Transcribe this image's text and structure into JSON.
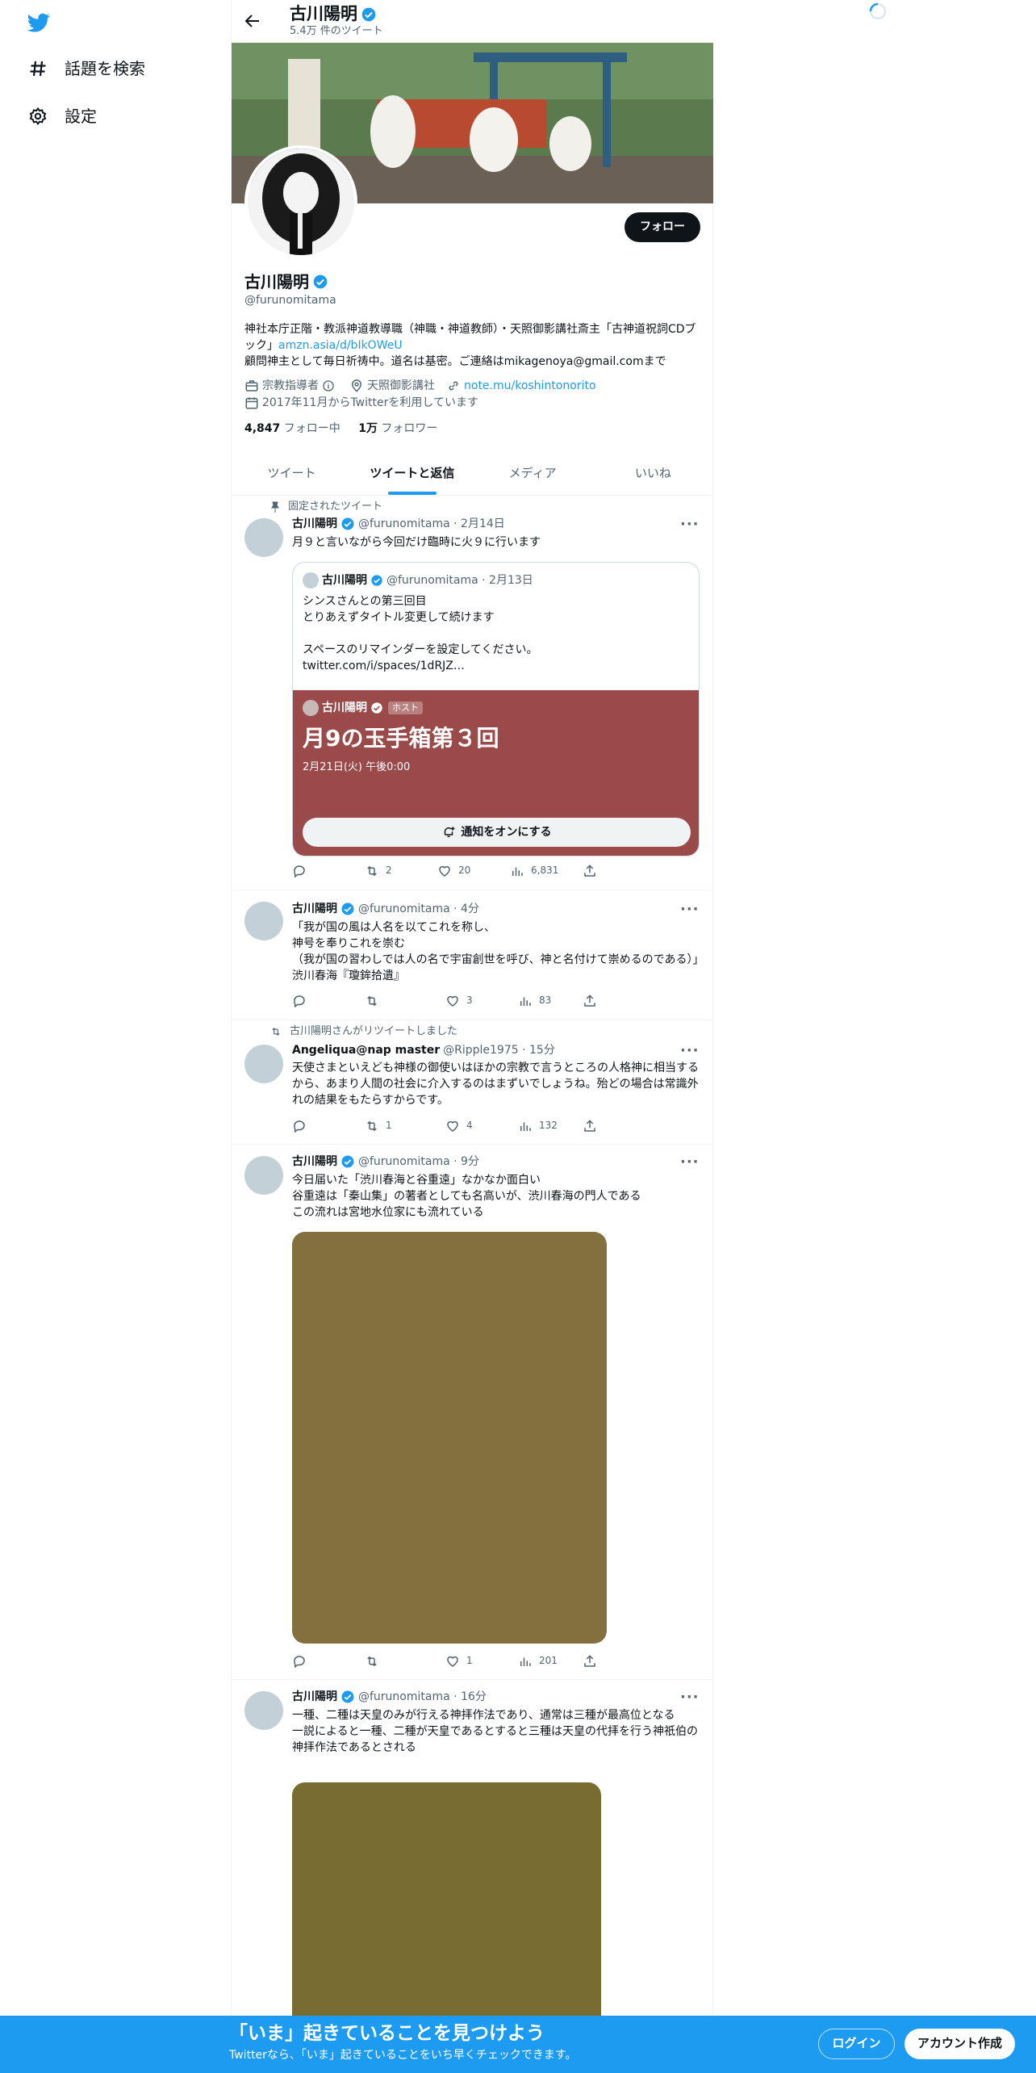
{
  "sidebar": {
    "items": [
      {
        "label": "話題を検索",
        "icon": "hashtag-icon"
      },
      {
        "label": "設定",
        "icon": "gear-icon"
      }
    ]
  },
  "header": {
    "name": "古川陽明",
    "tweet_count": "5.4万 件のツイート"
  },
  "profile": {
    "follow_label": "フォロー",
    "name": "古川陽明",
    "handle": "@furunomitama",
    "bio_line1": "神社本庁正階・教派神道教導職（神職・神道教師）・天照御影講社斎主「古神道祝詞CDブック」",
    "bio_link": "amzn.asia/d/bIkOWeU",
    "bio_line2": "顧問神主として毎日祈祷中。道名は基密。ご連絡はmikagenoya@gmail.comまで",
    "category": "宗教指導者",
    "location": "天照御影講社",
    "website": "note.mu/koshintonorito",
    "joined": "2017年11月からTwitterを利用しています",
    "following_count": "4,847",
    "following_label": "フォロー中",
    "followers_count": "1万",
    "followers_label": "フォロワー"
  },
  "tabs": [
    {
      "label": "ツイート",
      "active": false
    },
    {
      "label": "ツイートと返信",
      "active": true
    },
    {
      "label": "メディア",
      "active": false
    },
    {
      "label": "いいね",
      "active": false
    }
  ],
  "tweets": [
    {
      "context": "固定されたツイート",
      "name": "古川陽明",
      "meta": "@furunomitama · 2月14日",
      "text": "月９と言いながら今回だけ臨時に火９に行います",
      "quote": {
        "name": "古川陽明",
        "meta": "@furunomitama · 2月13日",
        "text": "シンスさんとの第三回目\nとりあえずタイトル変更して続けます\n\nスペースのリマインダーを設定してください。\ntwitter.com/i/spaces/1dRJZ…",
        "space_host_name": "古川陽明",
        "space_host_badge": "ホスト",
        "space_title": "月9の玉手箱第３回",
        "space_date": "2月21日(火) 午後0:00",
        "space_button": "通知をオンにする"
      },
      "replies": "",
      "retweets": "2",
      "likes": "20",
      "views": "6,831"
    },
    {
      "name": "古川陽明",
      "meta": "@furunomitama · 4分",
      "text": "「我が国の風は人名を以てこれを称し、\n神号を奉りこれを崇む\n（我が国の習わしでは人の名で宇宙創世を呼び、神と名付けて崇めるのである）」渋川春海『瓊鉾拾遺』",
      "replies": "",
      "retweets": "",
      "likes": "3",
      "views": "83"
    },
    {
      "context": "古川陽明さんがリツイートしました",
      "name": "Angeliqua@nap master",
      "meta": "@Ripple1975 · 15分",
      "text": "天使さまといえども神様の御使いはほかの宗教で言うところの人格神に相当するから、あまり人間の社会に介入するのはまずいでしょうね。殆どの場合は常識外れの結果をもたらすからです。",
      "replies": "",
      "retweets": "1",
      "likes": "4",
      "views": "132"
    },
    {
      "name": "古川陽明",
      "meta": "@furunomitama · 9分",
      "text": "今日届いた「渋川春海と谷重遠」なかなか面白い\n谷重遠は「秦山集」の著者としても名高いが、渋川春海の門人である\nこの流れは宮地水位家にも流れている",
      "media_color": "#84703e",
      "replies": "",
      "retweets": "",
      "likes": "1",
      "views": "201"
    },
    {
      "name": "古川陽明",
      "meta": "@furunomitama · 16分",
      "text": "一種、二種は天皇のみが行える神拝作法であり、通常は三種が最高位となる\n一説によると一種、二種が天皇であるとすると三種は天皇の代拝を行う神祇伯の神拝作法であるとされる",
      "media_color": "#786c30"
    }
  ],
  "bottom_banner": {
    "title": "「いま」起きていることを見つけよう",
    "subtitle": "Twitterなら、「いま」起きていることをいち早くチェックできます。",
    "login_label": "ログイン",
    "signup_label": "アカウント作成"
  },
  "colors": {
    "accent": "#1d9bf0",
    "space_card": "#9b4a4a"
  }
}
